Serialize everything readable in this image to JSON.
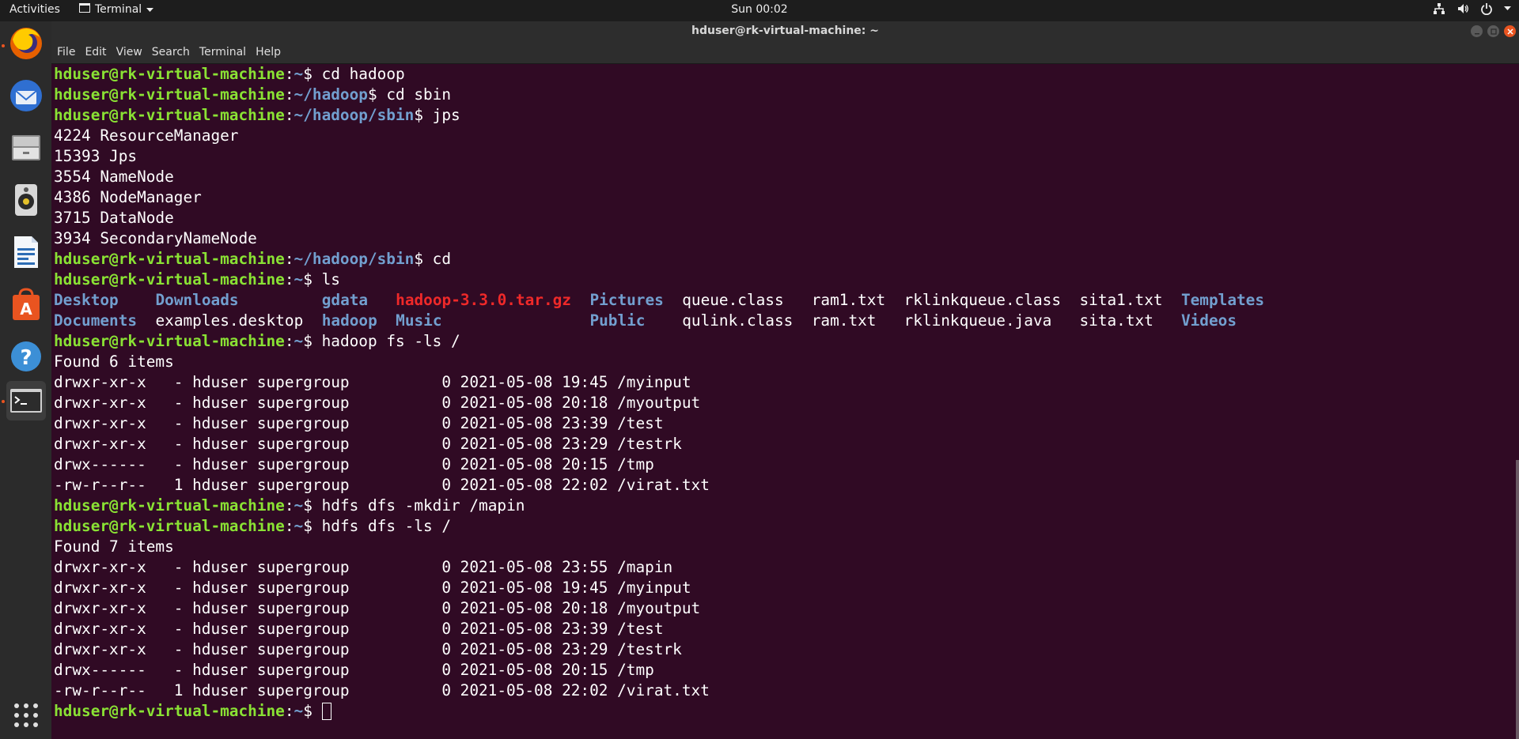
{
  "topbar": {
    "activities": "Activities",
    "app_name": "Terminal",
    "clock": "Sun 00:02"
  },
  "window": {
    "title": "hduser@rk-virtual-machine: ~"
  },
  "menu": [
    "File",
    "Edit",
    "View",
    "Search",
    "Terminal",
    "Help"
  ],
  "dock": [
    "firefox-icon",
    "thunderbird-icon",
    "files-icon",
    "rhythmbox-icon",
    "libreoffice-writer-icon",
    "software-center-icon",
    "help-icon",
    "terminal-icon"
  ],
  "prompt": {
    "user": "hduser@rk-virtual-machine",
    "colon": ":",
    "dollar": "$ "
  },
  "lines": [
    {
      "type": "prompt",
      "path": "~",
      "cmd": "cd hadoop"
    },
    {
      "type": "prompt",
      "path": "~/hadoop",
      "cmd": "cd sbin"
    },
    {
      "type": "prompt",
      "path": "~/hadoop/sbin",
      "cmd": "jps"
    },
    {
      "type": "text",
      "text": "4224 ResourceManager"
    },
    {
      "type": "text",
      "text": "15393 Jps"
    },
    {
      "type": "text",
      "text": "3554 NameNode"
    },
    {
      "type": "text",
      "text": "4386 NodeManager"
    },
    {
      "type": "text",
      "text": "3715 DataNode"
    },
    {
      "type": "text",
      "text": "3934 SecondaryNameNode"
    },
    {
      "type": "prompt",
      "path": "~/hadoop/sbin",
      "cmd": "cd"
    },
    {
      "type": "prompt",
      "path": "~",
      "cmd": "ls"
    },
    {
      "type": "ls",
      "items": [
        {
          "text": "Desktop",
          "color": "b",
          "col": 0
        },
        {
          "text": "Downloads",
          "color": "b",
          "col": 11
        },
        {
          "text": "gdata",
          "color": "b",
          "col": 29
        },
        {
          "text": "hadoop-3.3.0.tar.gz",
          "color": "r",
          "col": 37
        },
        {
          "text": "Pictures",
          "color": "b",
          "col": 58
        },
        {
          "text": "queue.class",
          "color": "w",
          "col": 68
        },
        {
          "text": "ram1.txt",
          "color": "w",
          "col": 82
        },
        {
          "text": "rklinkqueue.class",
          "color": "w",
          "col": 92
        },
        {
          "text": "sita1.txt",
          "color": "w",
          "col": 111
        },
        {
          "text": "Templates",
          "color": "b",
          "col": 122
        }
      ]
    },
    {
      "type": "ls",
      "items": [
        {
          "text": "Documents",
          "color": "b",
          "col": 0
        },
        {
          "text": "examples.desktop",
          "color": "w",
          "col": 11
        },
        {
          "text": "hadoop",
          "color": "b",
          "col": 29
        },
        {
          "text": "Music",
          "color": "b",
          "col": 37
        },
        {
          "text": "Public",
          "color": "b",
          "col": 58
        },
        {
          "text": "qulink.class",
          "color": "w",
          "col": 68
        },
        {
          "text": "ram.txt",
          "color": "w",
          "col": 82
        },
        {
          "text": "rklinkqueue.java",
          "color": "w",
          "col": 92
        },
        {
          "text": "sita.txt",
          "color": "w",
          "col": 111
        },
        {
          "text": "Videos",
          "color": "b",
          "col": 122
        }
      ]
    },
    {
      "type": "prompt",
      "path": "~",
      "cmd": "hadoop fs -ls /"
    },
    {
      "type": "text",
      "text": "Found 6 items"
    },
    {
      "type": "text",
      "text": "drwxr-xr-x   - hduser supergroup          0 2021-05-08 19:45 /myinput"
    },
    {
      "type": "text",
      "text": "drwxr-xr-x   - hduser supergroup          0 2021-05-08 20:18 /myoutput"
    },
    {
      "type": "text",
      "text": "drwxr-xr-x   - hduser supergroup          0 2021-05-08 23:39 /test"
    },
    {
      "type": "text",
      "text": "drwxr-xr-x   - hduser supergroup          0 2021-05-08 23:29 /testrk"
    },
    {
      "type": "text",
      "text": "drwx------   - hduser supergroup          0 2021-05-08 20:15 /tmp"
    },
    {
      "type": "text",
      "text": "-rw-r--r--   1 hduser supergroup          0 2021-05-08 22:02 /virat.txt"
    },
    {
      "type": "prompt",
      "path": "~",
      "cmd": "hdfs dfs -mkdir /mapin"
    },
    {
      "type": "prompt",
      "path": "~",
      "cmd": "hdfs dfs -ls /"
    },
    {
      "type": "text",
      "text": "Found 7 items"
    },
    {
      "type": "text",
      "text": "drwxr-xr-x   - hduser supergroup          0 2021-05-08 23:55 /mapin"
    },
    {
      "type": "text",
      "text": "drwxr-xr-x   - hduser supergroup          0 2021-05-08 19:45 /myinput"
    },
    {
      "type": "text",
      "text": "drwxr-xr-x   - hduser supergroup          0 2021-05-08 20:18 /myoutput"
    },
    {
      "type": "text",
      "text": "drwxr-xr-x   - hduser supergroup          0 2021-05-08 23:39 /test"
    },
    {
      "type": "text",
      "text": "drwxr-xr-x   - hduser supergroup          0 2021-05-08 23:29 /testrk"
    },
    {
      "type": "text",
      "text": "drwx------   - hduser supergroup          0 2021-05-08 20:15 /tmp"
    },
    {
      "type": "text",
      "text": "-rw-r--r--   1 hduser supergroup          0 2021-05-08 22:02 /virat.txt"
    },
    {
      "type": "prompt",
      "path": "~",
      "cmd": "",
      "cursor": true
    }
  ]
}
